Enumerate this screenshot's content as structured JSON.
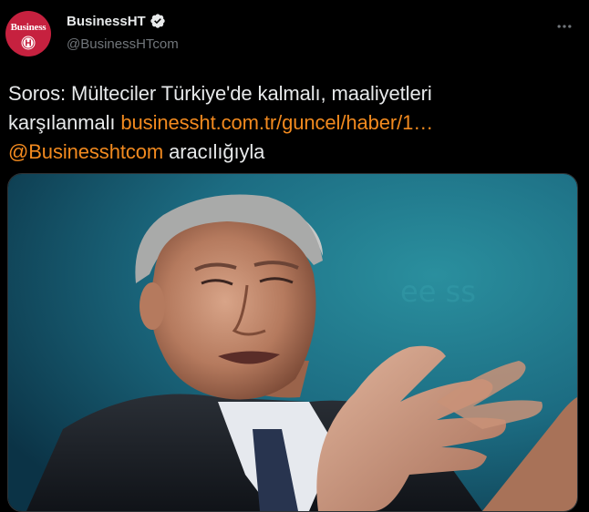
{
  "tweet": {
    "author": {
      "display_name": "BusinessHT",
      "handle": "@BusinessHTcom",
      "avatar_text": "Business",
      "verified": true,
      "verified_icon": "verified-badge-icon"
    },
    "more_icon": "more-horizontal-icon",
    "text": {
      "line1": "Soros: Mülteciler Türkiye'de kalmalı, maaliyetleri",
      "line2_prefix": "karşılanmalı ",
      "link": "businessht.com.tr/guncel/haber/1…",
      "mention": "@Businesshtcom",
      "suffix": " aracılığıyla"
    },
    "media": {
      "icon": "photo-of-elderly-man-gesturing"
    }
  },
  "colors": {
    "background": "#000000",
    "text": "#e7e9ea",
    "secondary": "#71767b",
    "link": "#f28a1f",
    "avatar": "#c6213f",
    "verified": "#e7e9ea"
  }
}
